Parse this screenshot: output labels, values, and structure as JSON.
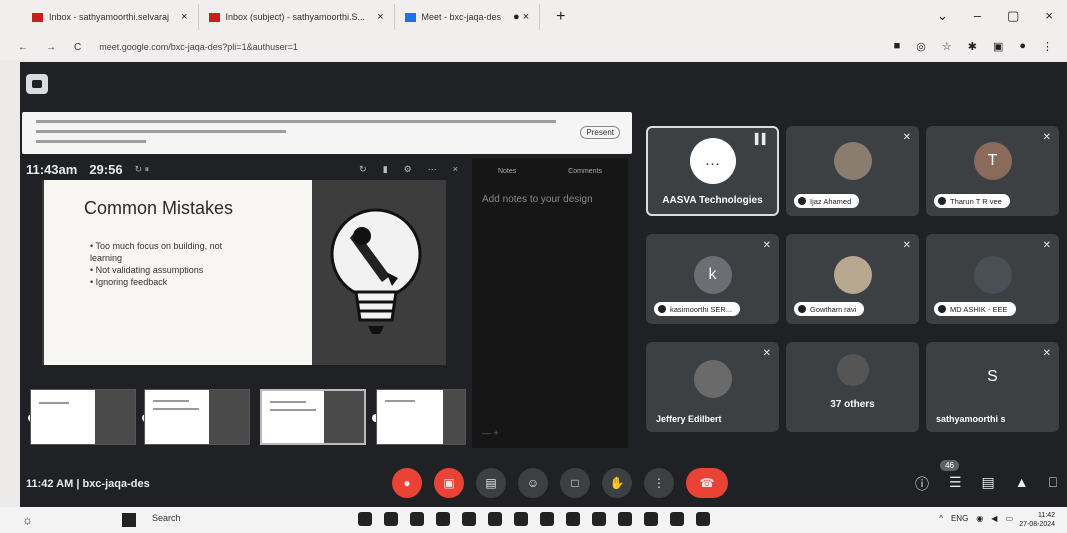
{
  "browser": {
    "tabs": [
      {
        "label": "Inbox - sathyamoorthi.selvaraj",
        "fav_color": "#c5221f"
      },
      {
        "label": "Inbox (subject) - sathyamoorthi.S...",
        "fav_color": "#c5221f"
      },
      {
        "label": "Meet - bxc-jaqa-des",
        "fav_color": "#1a73e8"
      }
    ],
    "tab_extra": "● ×",
    "new_tab": "+",
    "window_controls": [
      "⌄",
      "–",
      "▢",
      "×"
    ],
    "url": "meet.google.com/bxc-jaqa-des?pli=1&authuser=1",
    "nav": [
      "←",
      "→",
      "C"
    ]
  },
  "presentation": {
    "time_now": "11:43am",
    "elapsed": "29:56",
    "slide_title": "Common Mistakes",
    "bullets": [
      "Too much focus on building, not learning",
      "Not validating assumptions",
      "Ignoring feedback"
    ],
    "notes_hint": "Add notes to your design",
    "notes_tabs": [
      "Notes",
      "Comments"
    ],
    "present_button": "Present"
  },
  "participants": [
    {
      "name": "AASVA Technologies",
      "avatar": "…",
      "avatar_color": "#ffffff",
      "style": "center",
      "active": true
    },
    {
      "name": "Ijaz Ahamed",
      "avatar": "",
      "avatar_color": "#8a7d70",
      "style": "pill"
    },
    {
      "name": "Tharun T R vee",
      "avatar": "T",
      "avatar_color": "#8a6a5a",
      "style": "pill"
    },
    {
      "name": "kasimoorthi SER...",
      "avatar": "k",
      "avatar_color": "#6b6f74",
      "style": "pill"
    },
    {
      "name": "Gowtham ravi",
      "avatar": "",
      "avatar_color": "#b8a890",
      "style": "pill"
    },
    {
      "name": "MD ASHIK - EEE",
      "avatar": "",
      "avatar_color": "#4a4f55",
      "style": "pill"
    },
    {
      "name": "Jeffery Edilbert",
      "avatar": "",
      "avatar_color": "#6a6a6a",
      "style": "plain"
    },
    {
      "name": "37 others",
      "avatar": "",
      "avatar_color": "#555",
      "style": "center"
    },
    {
      "name": "sathyamoorthi s",
      "avatar": "S",
      "avatar_color": "#3c4043",
      "style": "plain"
    }
  ],
  "meeting": {
    "info": "11:42 AM  |  bxc-jaqa-des",
    "participant_count": "46",
    "controls": [
      "mic-off",
      "camera",
      "captions",
      "emoji",
      "present",
      "raise-hand",
      "more",
      "leave"
    ],
    "controls_glyphs": [
      "●",
      "▣",
      "▤",
      "☺",
      "□",
      "✋",
      "⋮",
      "☎"
    ],
    "side_glyphs": [
      "ⓘ",
      "☰",
      "▤",
      "▲",
      "⎕"
    ]
  },
  "taskbar": {
    "search": "Search",
    "lang": "ENG",
    "time": "11:42",
    "date": "27-08-2024"
  }
}
